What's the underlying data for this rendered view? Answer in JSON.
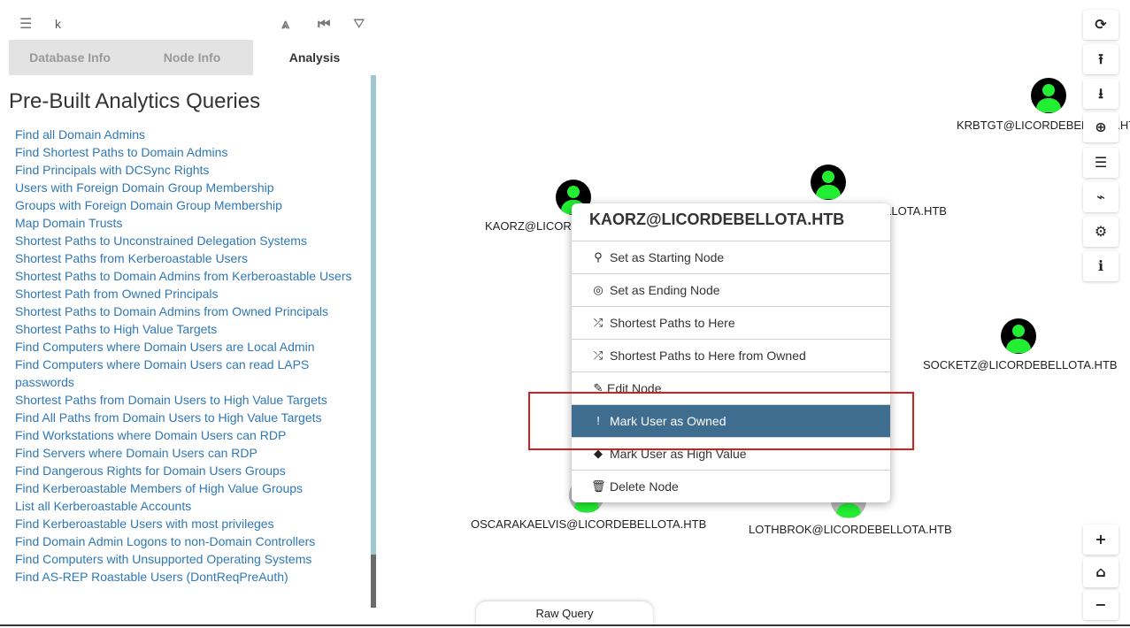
{
  "search": {
    "menu_icon": "hamburger-icon",
    "value": "k",
    "pathfinding_icon": "road-icon",
    "back_icon": "step-backward-icon",
    "filter_icon": "filter-icon"
  },
  "tabs": [
    {
      "label": "Database Info"
    },
    {
      "label": "Node Info"
    },
    {
      "label": "Analysis"
    }
  ],
  "analysis": {
    "heading": "Pre-Built Analytics Queries",
    "queries": [
      "Find all Domain Admins",
      "Find Shortest Paths to Domain Admins",
      "Find Principals with DCSync Rights",
      "Users with Foreign Domain Group Membership",
      "Groups with Foreign Domain Group Membership",
      "Map Domain Trusts",
      "Shortest Paths to Unconstrained Delegation Systems",
      "Shortest Paths from Kerberoastable Users",
      "Shortest Paths to Domain Admins from Kerberoastable Users",
      "Shortest Path from Owned Principals",
      "Shortest Paths to Domain Admins from Owned Principals",
      "Shortest Paths to High Value Targets",
      "Find Computers where Domain Users are Local Admin",
      "Find Computers where Domain Users can read LAPS passwords",
      "Shortest Paths from Domain Users to High Value Targets",
      "Find All Paths from Domain Users to High Value Targets",
      "Find Workstations where Domain Users can RDP",
      "Find Servers where Domain Users can RDP",
      "Find Dangerous Rights for Domain Users Groups",
      "Find Kerberoastable Members of High Value Groups",
      "List all Kerberoastable Accounts",
      "Find Kerberoastable Users with most privileges",
      "Find Domain Admin Logons to non-Domain Controllers",
      "Find Computers with Unsupported Operating Systems",
      "Find AS-REP Roastable Users (DontReqPreAuth)"
    ]
  },
  "graph": {
    "node_color": "#22ee33",
    "nodes": {
      "krbtgt": "KRBTGT@LICORDEBELLOTA.HTB",
      "franco": "FRANCOTESLU@LICORDEBELLOTA.HTB",
      "kaorz": "KAORZ@LICORDEBELLOTA.HTB",
      "socketz": "SOCKETZ@LICORDEBELLOTA.HTB",
      "oscar": "OSCARAKAELVIS@LICORDEBELLOTA.HTB",
      "lothbrok": "LOTHBROK@LICORDEBELLOTA.HTB"
    }
  },
  "context_menu": {
    "title": "KAORZ@LICORDEBELLOTA.HTB",
    "selected_color": "#3f6d8f",
    "items": [
      {
        "label": "Set as Starting Node",
        "icon": "map-marker-icon"
      },
      {
        "label": "Set as Ending Node",
        "icon": "bullseye-icon"
      },
      {
        "label": "Shortest Paths to Here",
        "icon": "random-icon"
      },
      {
        "label": "Shortest Paths to Here from Owned",
        "icon": "random-icon"
      },
      {
        "label": "Edit Node",
        "icon": "edit-icon"
      },
      {
        "label": "Mark User as Owned",
        "icon": "exclamation-icon"
      },
      {
        "label": "Mark User as High Value",
        "icon": "gem-icon"
      },
      {
        "label": "Delete Node",
        "icon": "trash-icon"
      }
    ]
  },
  "toolbar": {
    "refresh_icon": "refresh-icon",
    "upload_icon": "upload-icon",
    "download_icon": "download-icon",
    "import_icon": "circle-upload-icon",
    "tasks_icon": "tasks-icon",
    "chart_icon": "area-chart-icon",
    "settings_icon": "cogs-icon",
    "info_icon": "info-icon",
    "zoom_in_icon": "plus-icon",
    "home_icon": "home-icon",
    "zoom_out_icon": "minus-icon"
  },
  "raw_query": {
    "label": "Raw Query"
  }
}
